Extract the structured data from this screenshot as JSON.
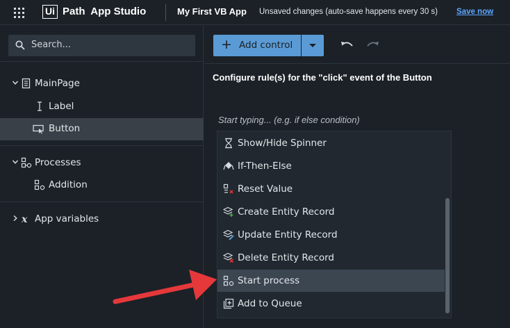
{
  "topbar": {
    "logo_boxed": "Ui",
    "logo_rest": "Path  App Studio",
    "app_name": "My First VB App",
    "unsaved_text": "Unsaved changes (auto-save happens every 30 s)",
    "save_now": "Save now"
  },
  "sidebar": {
    "search_placeholder": "Search...",
    "tree": [
      {
        "label": "MainPage",
        "icon": "page-icon",
        "expanded": true
      },
      {
        "label": "Label",
        "icon": "text-cursor-icon"
      },
      {
        "label": "Button",
        "icon": "button-icon",
        "selected": true
      },
      {
        "label": "Processes",
        "icon": "processes-icon",
        "expanded": true
      },
      {
        "label": "Addition",
        "icon": "process-icon"
      },
      {
        "label": "App variables",
        "icon": "variable-x-icon",
        "expanded": false
      }
    ]
  },
  "toolbar": {
    "add_control": "Add control",
    "undo_icon": "undo-icon",
    "redo_icon": "redo-icon"
  },
  "main": {
    "title": "Configure rule(s) for the \"click\" event of the Button",
    "input_placeholder": "Start typing... (e.g. if else condition)",
    "dropdown": [
      {
        "label": "Show/Hide Spinner",
        "icon": "hourglass-icon"
      },
      {
        "label": "If-Then-Else",
        "icon": "branch-icon"
      },
      {
        "label": "Reset Value",
        "icon": "reset-icon"
      },
      {
        "label": "Create Entity Record",
        "icon": "entity-create-icon"
      },
      {
        "label": "Update Entity Record",
        "icon": "entity-update-icon"
      },
      {
        "label": "Delete Entity Record",
        "icon": "entity-delete-icon"
      },
      {
        "label": "Start process",
        "icon": "process-start-icon",
        "highlighted": true
      },
      {
        "label": "Add to Queue",
        "icon": "queue-icon"
      }
    ]
  },
  "colors": {
    "background": "#1b2127",
    "accent": "#5b9bd5",
    "link": "#5ea7ff",
    "selected_row": "#3a4047",
    "highlight_row": "#3c4651",
    "annotation_arrow": "#e5383b"
  }
}
